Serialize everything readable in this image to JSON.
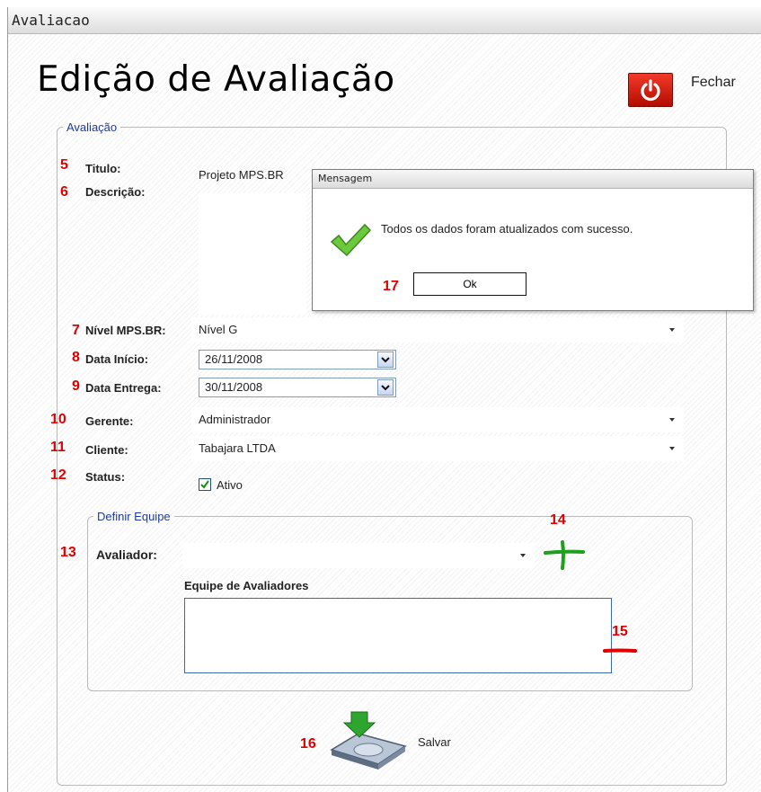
{
  "window": {
    "title": "Avaliacao"
  },
  "header": {
    "title": "Edição de Avaliação",
    "close_label": "Fechar"
  },
  "colors": {
    "accent_red": "#e00000",
    "legend_blue": "#1f3a9e",
    "close_button": "#d9200f",
    "add_green": "#1ea01e"
  },
  "form": {
    "legend": "Avaliação",
    "titulo": {
      "number": "5",
      "label": "Titulo:",
      "value": "Projeto MPS.BR"
    },
    "descricao": {
      "number": "6",
      "label": "Descrição:",
      "value": ""
    },
    "nivel": {
      "number": "7",
      "label": "Nível MPS.BR:",
      "value": "Nível G"
    },
    "data_inicio": {
      "number": "8",
      "label": "Data Início:",
      "value": "26/11/2008"
    },
    "data_entrega": {
      "number": "9",
      "label": "Data Entrega:",
      "value": "30/11/2008"
    },
    "gerente": {
      "number": "10",
      "label": "Gerente:",
      "value": "Administrador"
    },
    "cliente": {
      "number": "11",
      "label": "Cliente:",
      "value": "Tabajara LTDA"
    },
    "status": {
      "number": "12",
      "label": "Status:",
      "checkbox_label": "Ativo",
      "checked": true
    }
  },
  "team": {
    "legend": "Definir Equipe",
    "avaliador": {
      "number": "13",
      "label": "Avaliador:",
      "value": ""
    },
    "add_number": "14",
    "remove_number": "15",
    "list_label": "Equipe de Avaliadores",
    "members": []
  },
  "save": {
    "number": "16",
    "label": "Salvar"
  },
  "dialog": {
    "title": "Mensagem",
    "message": "Todos os dados foram atualizados com sucesso.",
    "ok_label": "Ok",
    "ok_number": "17"
  }
}
